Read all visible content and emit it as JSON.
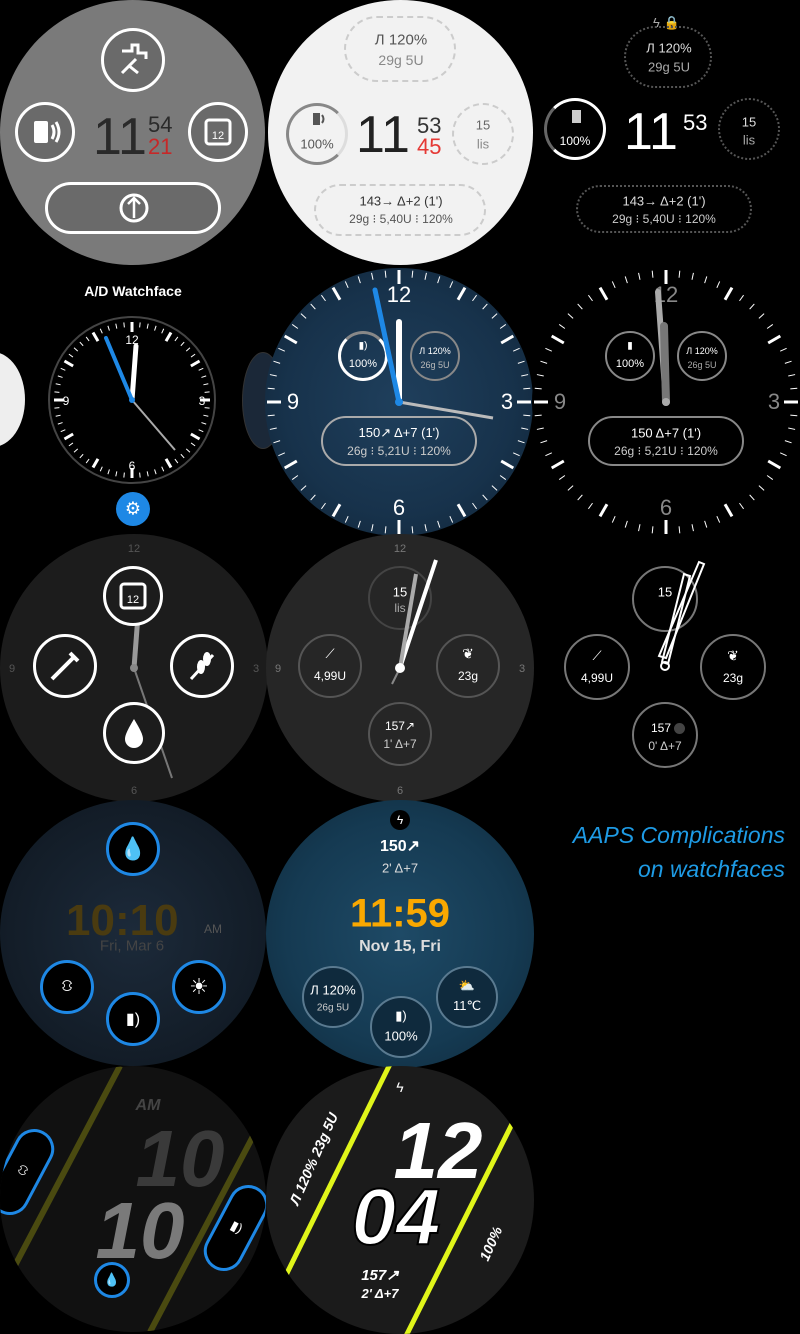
{
  "face1": {
    "hour": "11",
    "min": "54",
    "sec": "21",
    "icons": [
      "pump-icon",
      "battery-icon",
      "calendar-icon",
      "sync-icon"
    ],
    "cal_day": "12"
  },
  "face2": {
    "basal": "Л 120%",
    "iob": "29g 5U",
    "batt": "100%",
    "hour": "11",
    "min": "53",
    "sec": "45",
    "temp": "15",
    "temp_unit": "lis",
    "bg": "143→ Δ+2 (1')",
    "sub": "29g ⁝ 5,40U ⁝ 120%"
  },
  "face3": {
    "basal": "Л 120%",
    "iob": "29g 5U",
    "batt": "100%",
    "hour": "11",
    "min": "53",
    "temp": "15",
    "temp_unit": "lis",
    "bg": "143→ Δ+2 (1')",
    "sub": "29g ⁝ 5,40U ⁝ 120%"
  },
  "label_ad": "A/D Watchface",
  "face4": {
    "n12": "12",
    "n3": "3",
    "n6": "6",
    "n9": "9"
  },
  "face5": {
    "n12": "12",
    "n3": "3",
    "n6": "6",
    "n9": "9",
    "batt": "100%",
    "basal": "Л 120%",
    "iob": "26g 5U",
    "bg": "150↗ Δ+7 (1')",
    "sub": "26g ⁝ 5,21U ⁝ 120%"
  },
  "face6": {
    "n12": "12",
    "n3": "3",
    "n6": "6",
    "n9": "9",
    "batt": "100%",
    "basal": "Л 120%",
    "iob": "26g 5U",
    "bg": "150  Δ+7 (1')",
    "sub": "26g ⁝ 5,21U ⁝ 120%"
  },
  "face7": {
    "n12": "12",
    "n3": "3",
    "n6": "6",
    "n9": "9",
    "cal_day": "12"
  },
  "face8": {
    "n12": "12",
    "n3": "3",
    "n6": "6",
    "n9": "9",
    "temp": "15",
    "temp_unit": "lis",
    "insulin": "4,99U",
    "carbs": "23g",
    "bg": "157↗",
    "delta": "1' Δ+7"
  },
  "face9": {
    "temp": "15",
    "insulin": "4,99U",
    "carbs": "23g",
    "bg": "157",
    "delta": "0' Δ+7"
  },
  "face10": {
    "time": "10:10",
    "ampm": "AM",
    "date": "Fri, Mar 6"
  },
  "face11": {
    "bg": "150↗",
    "delta": "2' Δ+7",
    "time": "11:59",
    "date": "Nov 15, Fri",
    "basal": "Л 120%",
    "iob": "26g 5U",
    "batt": "100%",
    "weather": "11℃"
  },
  "face12": {
    "ampm": "AM",
    "h": "10",
    "m": "10"
  },
  "face13": {
    "h": "12",
    "m": "04",
    "side": "Л 120% 23g 5U",
    "batt": "100%",
    "bg": "157↗",
    "delta": "2' Δ+7"
  },
  "caption": {
    "line1": "AAPS Complications",
    "line2": "on watchfaces"
  },
  "colors": {
    "accent_blue": "#1e88e5",
    "red": "#e53935",
    "orange": "#f9a800",
    "yellow": "#e0f51a"
  }
}
